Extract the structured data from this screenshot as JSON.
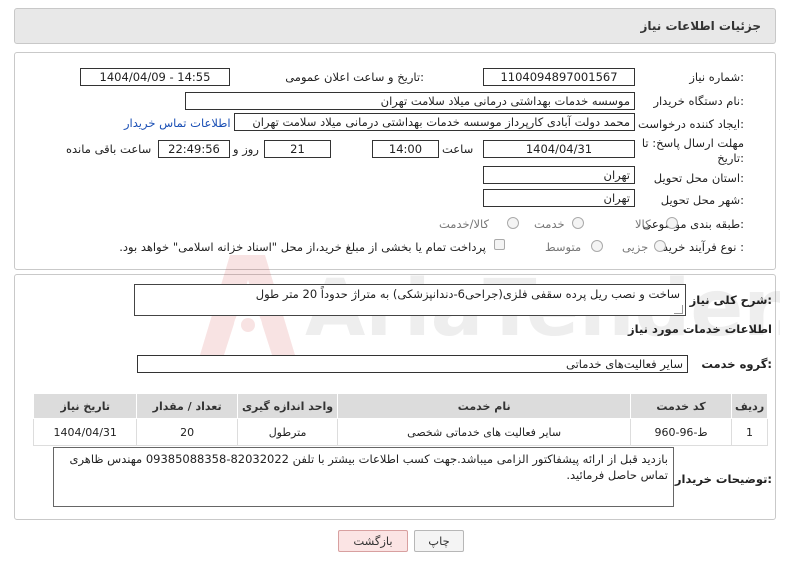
{
  "header": {
    "title": "جزئیات اطلاعات نیاز"
  },
  "fields": {
    "need_number_label": "شماره نیاز:",
    "need_number": "1104094897001567",
    "announce_label": "تاریخ و ساعت اعلان عمومی:",
    "announce_value": "1404/04/09 - 14:55",
    "buyer_label": "نام دستگاه خریدار:",
    "buyer_value": "موسسه خدمات بهداشتی درمانی میلاد سلامت تهران",
    "creator_label": "ایجاد کننده درخواست:",
    "creator_value": "محمد دولت آبادی کارپرداز موسسه خدمات بهداشتی درمانی میلاد سلامت تهران",
    "contact_link": "اطلاعات تماس خریدار",
    "deadline_label_1": "مهلت ارسال پاسخ: تا",
    "deadline_label_2": "تاریخ:",
    "deadline_date": "1404/04/31",
    "time_label": "ساعت",
    "deadline_time": "14:00",
    "days_value": "21",
    "days_label": "روز و",
    "remaining_time": "22:49:56",
    "remaining_label": "ساعت باقی مانده",
    "province_label": "استان محل تحویل:",
    "province_value": "تهران",
    "city_label": "شهر محل تحویل:",
    "city_value": "تهران",
    "category_label": "طبقه بندی موضوعی:",
    "category_options": [
      "کالا",
      "خدمت",
      "کالا/خدمت"
    ],
    "process_label": "نوع فرآیند خرید :",
    "process_options": [
      "جزیی",
      "متوسط"
    ],
    "payment_note": "پرداخت تمام یا بخشی از مبلغ خرید،از محل \"اسناد خزانه اسلامی\" خواهد بود."
  },
  "summary": {
    "label": "شرح کلی نیاز:",
    "value": "ساخت و نصب ریل پرده سقفی فلزی(جراحی6-دندانپزشکی) به متراژ حدوداً 20 متر طول"
  },
  "services": {
    "section_title": "اطلاعات خدمات مورد نیاز",
    "group_label": "گروه خدمت:",
    "group_value": "سایر فعالیت‌های خدماتی",
    "columns": [
      "ردیف",
      "کد خدمت",
      "نام خدمت",
      "واحد اندازه گیری",
      "تعداد / مقدار",
      "تاریخ نیاز"
    ],
    "rows": [
      {
        "index": "1",
        "code": "ط-96-960",
        "name": "سایر فعالیت های خدماتی شخصی",
        "unit": "مترطول",
        "qty": "20",
        "date": "1404/04/31"
      }
    ]
  },
  "buyer_notes": {
    "label": "توضیحات خریدار:",
    "value": "بازدید قبل از ارائه پیشفاکتور الزامی میباشد.جهت کسب اطلاعات بیشتر با تلفن 82032022-09385088358 مهندس ظاهری تماس حاصل فرمائید."
  },
  "buttons": {
    "print": "چاپ",
    "back": "بازگشت"
  },
  "watermark": {
    "text": "AriaTender.neT"
  },
  "colors": {
    "link": "#1a4fb5",
    "header_bg": "#e8e8e8",
    "table_header": "#dcdcdc",
    "back_button": "#fbe4e4"
  }
}
